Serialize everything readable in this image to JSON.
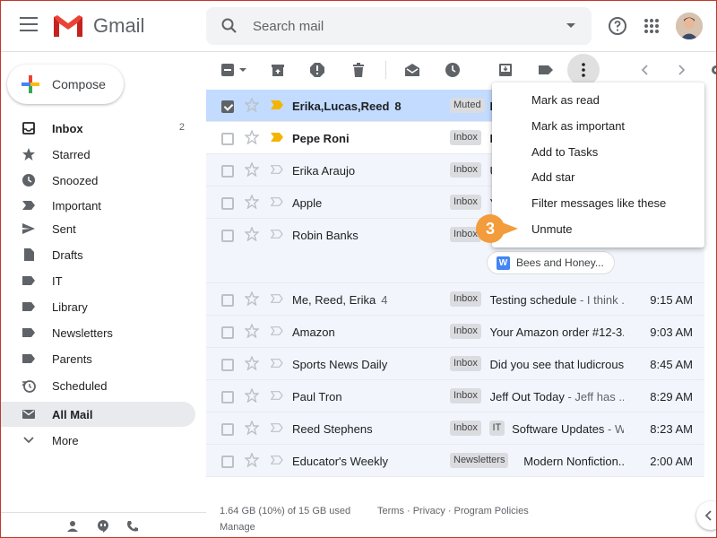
{
  "app": {
    "name": "Gmail",
    "brand_red": "#ea4335"
  },
  "search": {
    "placeholder": "Search mail"
  },
  "compose": {
    "label": "Compose"
  },
  "sidebar": {
    "items": [
      {
        "label": "Inbox",
        "count": "2",
        "icon": "inbox-icon",
        "bold": true
      },
      {
        "label": "Starred",
        "icon": "star-icon"
      },
      {
        "label": "Snoozed",
        "icon": "clock-icon"
      },
      {
        "label": "Important",
        "icon": "important-icon"
      },
      {
        "label": "Sent",
        "icon": "send-icon"
      },
      {
        "label": "Drafts",
        "icon": "draft-icon"
      },
      {
        "label": "IT",
        "icon": "label-icon"
      },
      {
        "label": "Library",
        "icon": "label-icon"
      },
      {
        "label": "Newsletters",
        "icon": "label-icon"
      },
      {
        "label": "Parents",
        "icon": "label-icon"
      },
      {
        "label": "Scheduled",
        "icon": "scheduled-icon"
      },
      {
        "label": "All Mail",
        "icon": "all-mail-icon",
        "active": true
      },
      {
        "label": "More",
        "icon": "chevron-down-icon"
      }
    ]
  },
  "emails": [
    {
      "sender": "Erika,Lucas,Reed",
      "count": "8",
      "labels": [
        "Muted"
      ],
      "subject": "H",
      "snippet": "",
      "time": "",
      "unread": true,
      "selected": true,
      "important": true
    },
    {
      "sender": "Pepe Roni",
      "count": "",
      "labels": [
        "Inbox"
      ],
      "subject": "B",
      "snippet": "",
      "time": "",
      "unread": true,
      "important": true
    },
    {
      "sender": "Erika Araujo",
      "count": "",
      "labels": [
        "Inbox"
      ],
      "subject": "Up",
      "snippet": "",
      "time": ""
    },
    {
      "sender": "Apple",
      "count": "",
      "labels": [
        "Inbox"
      ],
      "subject": "Yo",
      "snippet": "",
      "time": ""
    },
    {
      "sender": "Robin Banks",
      "count": "",
      "labels": [
        "Inbox"
      ],
      "subject": "",
      "snippet": "",
      "time": "",
      "attachment": "Bees and Honey..."
    },
    {
      "sender": "Me, Reed, Erika",
      "count": "4",
      "labels": [
        "Inbox"
      ],
      "subject": "Testing schedule",
      "snippet": " - I think ...",
      "time": "9:15 AM"
    },
    {
      "sender": "Amazon",
      "count": "",
      "labels": [
        "Inbox"
      ],
      "subject": "Your Amazon order #12-3...",
      "snippet": "",
      "time": "9:03 AM"
    },
    {
      "sender": "Sports News Daily",
      "count": "",
      "labels": [
        "Inbox"
      ],
      "subject": "Did you see that ludicrous...",
      "snippet": "",
      "time": "8:45 AM"
    },
    {
      "sender": "Paul Tron",
      "count": "",
      "labels": [
        "Inbox"
      ],
      "subject": "Jeff Out Today",
      "snippet": " - Jeff has ...",
      "time": "8:29 AM"
    },
    {
      "sender": "Reed Stephens",
      "count": "",
      "labels": [
        "Inbox",
        "IT"
      ],
      "subject": "Software Updates",
      "snippet": " - W...",
      "time": "8:23 AM"
    },
    {
      "sender": "Educator's Weekly",
      "count": "",
      "labels": [
        "Newsletters"
      ],
      "subject": "Modern Nonfiction...",
      "snippet": "",
      "time": "2:00 AM"
    }
  ],
  "menu": {
    "items": [
      "Mark as read",
      "Mark as important",
      "Add to Tasks",
      "Add star",
      "Filter messages like these",
      "Unmute"
    ]
  },
  "callout": {
    "number": "3",
    "color": "#f39c3c"
  },
  "footer": {
    "storage": "1.64 GB (10%) of 15 GB used",
    "manage": "Manage",
    "links": "Terms · Privacy · Program Policies"
  }
}
